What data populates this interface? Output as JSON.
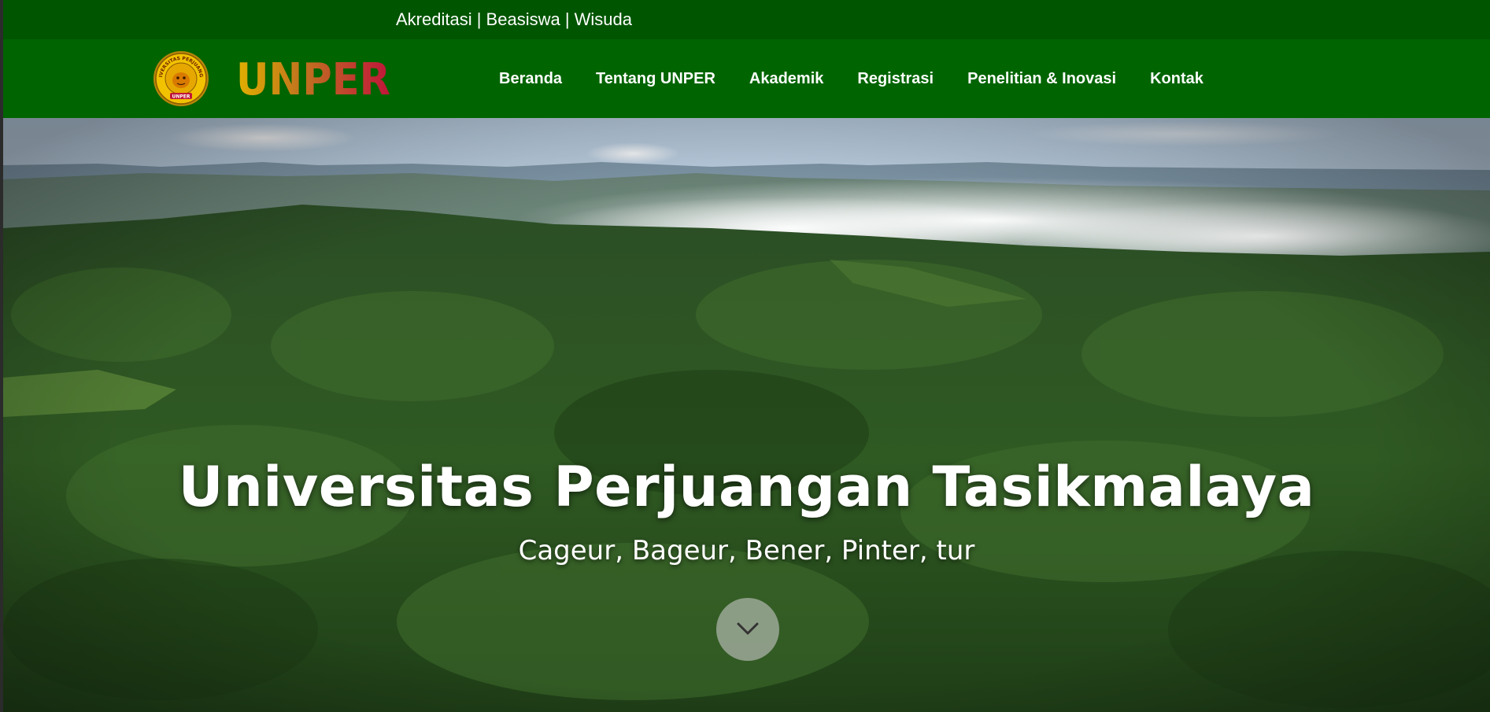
{
  "topbar": {
    "links": [
      "Akreditasi",
      "Beasiswa",
      "Wisuda"
    ],
    "separator": "|"
  },
  "brand": {
    "seal_text": "UNIVERSITAS PERJUANGAN",
    "seal_bottom": "UNPER",
    "wordmark": "UNPER"
  },
  "nav": {
    "items": [
      "Beranda",
      "Tentang UNPER",
      "Akademik",
      "Registrasi",
      "Penelitian & Inovasi",
      "Kontak"
    ]
  },
  "hero": {
    "title": "Universitas Perjuangan Tasikmalaya",
    "subtitle": "Cageur, Bageur, Bener, Pinter, tur"
  },
  "icons": {
    "scroll": "chevron-down-icon"
  },
  "colors": {
    "topbar": "#005500",
    "navbar": "#006400",
    "gold": "#d4a017",
    "red": "#c0153a"
  }
}
